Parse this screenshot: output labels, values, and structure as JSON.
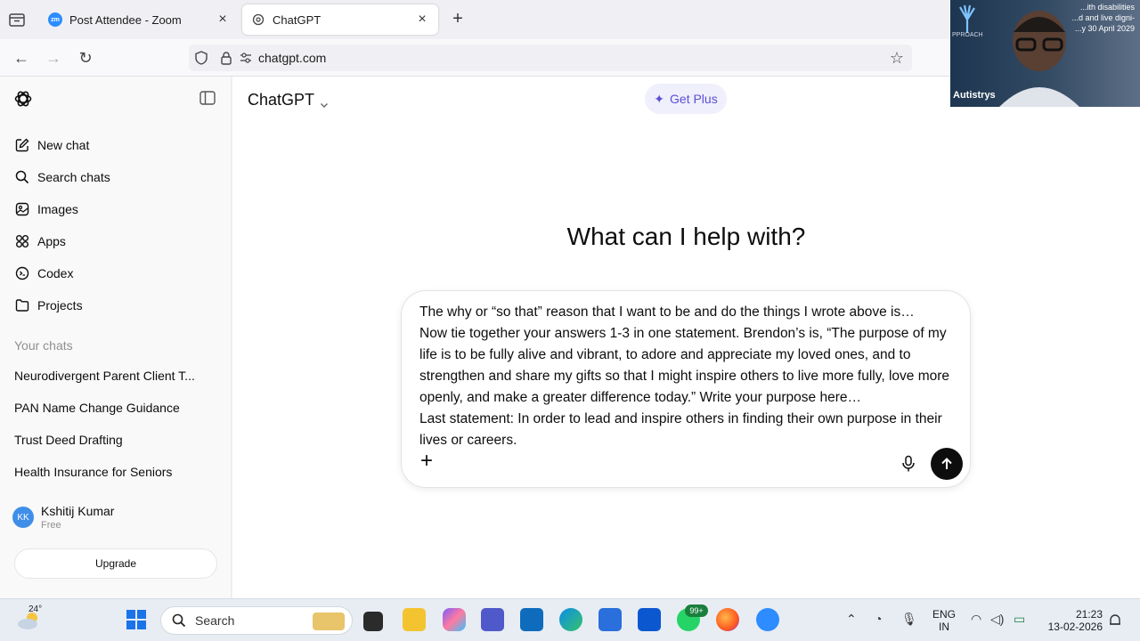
{
  "browser": {
    "tabs": [
      {
        "title": "Post Attendee - Zoom",
        "favicon": "zoom-icon",
        "active": false
      },
      {
        "title": "ChatGPT",
        "favicon": "chatgpt-icon",
        "active": true
      }
    ],
    "url": "chatgpt.com"
  },
  "sidebar": {
    "nav": [
      {
        "label": "New chat",
        "icon": "pencil-icon"
      },
      {
        "label": "Search chats",
        "icon": "search-icon"
      },
      {
        "label": "Images",
        "icon": "image-icon"
      },
      {
        "label": "Apps",
        "icon": "apps-icon"
      },
      {
        "label": "Codex",
        "icon": "codex-icon"
      },
      {
        "label": "Projects",
        "icon": "folder-icon"
      }
    ],
    "section_label": "Your chats",
    "chats": [
      "Neurodivergent Parent Client T...",
      "PAN Name Change Guidance",
      "Trust Deed Drafting",
      "Health Insurance for Seniors"
    ],
    "user": {
      "initials": "KK",
      "name": "Kshitij Kumar",
      "plan": "Free"
    },
    "upgrade_label": "Upgrade"
  },
  "main": {
    "model_label": "ChatGPT",
    "get_plus_label": "Get Plus",
    "headline": "What can I help with?",
    "composer_text": "The why or “so that” reason that I want to be and do the things I wrote above is…\nNow tie together your answers 1-3 in one statement. Brendon’s is, “The purpose of my life is to be fully alive and vibrant, to adore and appreciate my loved ones, and to strengthen and share my gifts so that I might inspire others to live more fully, love more openly, and make a greater difference today.” Write your purpose here…\nLast statement: In order to lead and inspire others in finding their own purpose in their lives or careers."
  },
  "video": {
    "banner_text": "...ith disabilities\n...d and live digni-\n...y 30 April 2029",
    "tag_text": "PPROACH",
    "name": "Autistrys"
  },
  "taskbar": {
    "temperature": "24°",
    "search_label": "Search",
    "whatsapp_badge": "99+",
    "lang_line1": "ENG",
    "lang_line2": "IN",
    "time": "21:23",
    "date": "13-02-2026"
  },
  "colors": {
    "accent": "#5b4fd6",
    "avatar": "#3f8ee8",
    "send_button": "#0d0d0d"
  }
}
